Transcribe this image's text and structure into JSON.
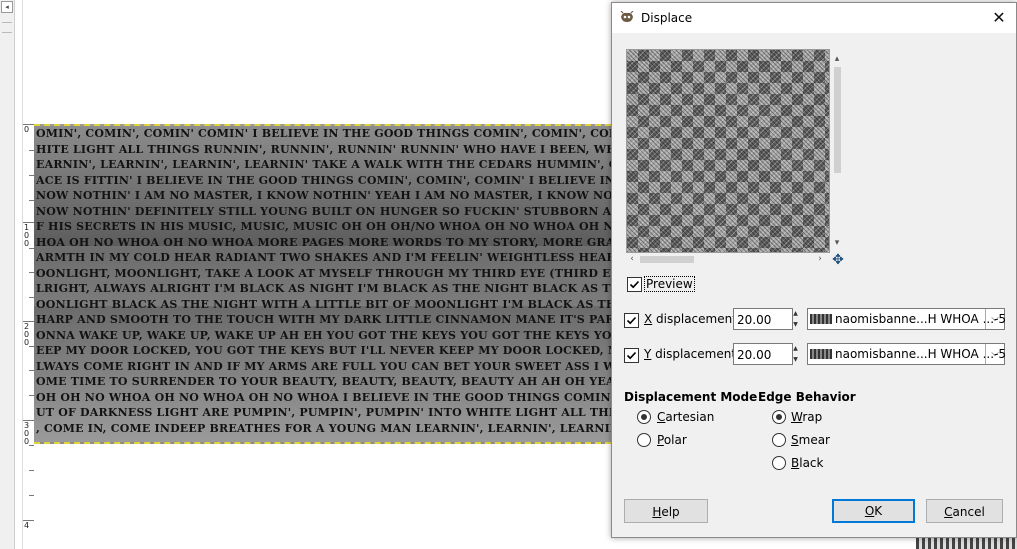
{
  "canvas": {
    "left_button_glyph": "◂",
    "ruler_labels": [
      "0",
      "1\n0\n0",
      "2\n0\n0",
      "3\n0\n0",
      "4"
    ],
    "lyrics_lines": [
      "OMIN', COMIN', COMIN' COMIN' I BELIEVE IN THE GOOD THINGS COMIN', COMIN', COMIN' OUT OF DARKNESS",
      "HITE LIGHT ALL THINGS RUNNIN', RUNNIN', RUNNIN' RUNNIN' WHO HAVE I BEEN, WHO AM I BECOMIN'? COME IN,",
      "EARNIN', LEARNIN', LEARNIN', LEARNIN' TAKE A WALK WITH THE CEDARS HUMMIN', CITYSCAPE, PINK SUNSET S",
      "ACE IS FITTIN' I BELIEVE IN THE GOOD THINGS COMIN', COMIN', COMIN' I BELIEVE IN THE GOOD THIN",
      "NOW NOTHIN' I AM NO MASTER, I KNOW NOTHIN' YEAH I AM NO MASTER, I KNOW NOTHIN' BUT I AM A SERVA",
      "NOW NOTHIN' DEFINITELY STILL YOUNG BUILT ON HUNGER SO FUCKIN' STUBBORN A LOT OF SELF-WORK UNDON",
      "F HIS SECRETS IN HIS MUSIC, MUSIC, MUSIC OH OH OH/NO WHOA OH NO WHOA OH NO WHOA OH NO WHOA OH N",
      "HOA OH NO WHOA OH NO WHOA MORE PAGES MORE WORDS TO MY STORY, MORE GRACE, MORE MEANING UNFO",
      "ARMTH IN MY COLD HEAR RADIANT TWO SHAKES AND I'M FEELIN' WEIGHTLESS HEART ACHES BUT ITS ACTUA",
      "OONLIGHT, MOONLIGHT, TAKE A LOOK AT MYSELF THROUGH MY THIRD EYE (THIRD EYE, THIRD EYE, THI",
      "LRIGHT, ALWAYS ALRIGHT I'M BLACK AS NIGHT I'M BLACK AS THE NIGHT BLACK AS THE NIGHT I'M BLACK AS",
      "OONLIGHT BLACK AS THE NIGHT WITH A LITTLE BIT OF MOONLIGHT I'M BLACK AS THE NIGHT WITH A LITTLE",
      "HARP AND SMOOTH TO THE TOUCH WITH MY DARK LITTLE CINNAMON MANE IT'S PART OF MY WAKE UP, UH-",
      "ONNA WAKE UP, WAKE UP, WAKE UP AH EH YOU GOT THE KEYS YOU GOT THE KEYS YOU GOT THE KEYS YOU",
      "EEP MY DOOR LOCKED, YOU GOT THE KEYS BUT I'LL NEVER KEEP MY DOOR LOCKED, NAH YOU GOT THE KE",
      "LWAYS COME RIGHT IN AND IF MY ARMS ARE FULL YOU CAN BET YOUR SWEET ASS I WILL DROP THAT SHIT RIGH",
      "OME TIME TO SURRENDER TO YOUR BEAUTY, BEAUTY, BEAUTY, BEAUTY AH AH OH YEAH... OH/NO WHOA OH",
      "OH OH NO WHOA OH NO WHOA OH NO WHOA I BELIEVE IN THE GOOD THINGS COMIN', COMIN', COMIN' COMIN'",
      "UT OF DARKNESS LIGHT ARE PUMPIN', PUMPIN', PUMPIN' INTO WHITE LIGHT ALL THINGS RUNNIN', RUNNIN', RU",
      ", COME IN, COME INDEEP BREATHES FOR A YOUNG MAN LEARNIN', LEARNIN', LEARNIN' TAKE A WO"
    ]
  },
  "dialog": {
    "title": "Displace",
    "close_glyph": "✕",
    "preview": {
      "label": "Preview",
      "checked": true,
      "scroll_up": "▴",
      "scroll_down": "▾",
      "scroll_left": "‹",
      "scroll_right": "›",
      "nav_glyph": "✥"
    },
    "x_displacement": {
      "label": "X displacement",
      "underline": "X",
      "rest": " displacement",
      "checked": true,
      "value": "20.00",
      "map": "naomisbanne...H WHOA ...-5"
    },
    "y_displacement": {
      "label": "Y displacement",
      "underline": "Y",
      "rest": " displacement",
      "checked": true,
      "value": "20.00",
      "map": "naomisbanne...H WHOA ...-5"
    },
    "spin_up": "▲",
    "spin_down": "▼",
    "combo_arrow": "⌵",
    "displacement_mode": {
      "heading": "Displacement Mode",
      "options": [
        {
          "label": "Cartesian",
          "ul": "C",
          "rest": "artesian",
          "selected": true
        },
        {
          "label": "Polar",
          "ul": "P",
          "rest": "olar",
          "selected": false
        }
      ]
    },
    "edge_behavior": {
      "heading": "Edge Behavior",
      "options": [
        {
          "label": "Wrap",
          "ul": "W",
          "rest": "rap",
          "selected": true
        },
        {
          "label": "Smear",
          "ul": "S",
          "rest": "mear",
          "selected": false
        },
        {
          "label": "Black",
          "ul": "B",
          "rest": "lack",
          "selected": false
        }
      ]
    },
    "buttons": {
      "help": {
        "ul": "H",
        "rest": "elp"
      },
      "ok": {
        "ul": "O",
        "rest": "K"
      },
      "cancel": {
        "ul": "C",
        "rest": "ancel"
      }
    },
    "accent_color": "#0078d7"
  }
}
